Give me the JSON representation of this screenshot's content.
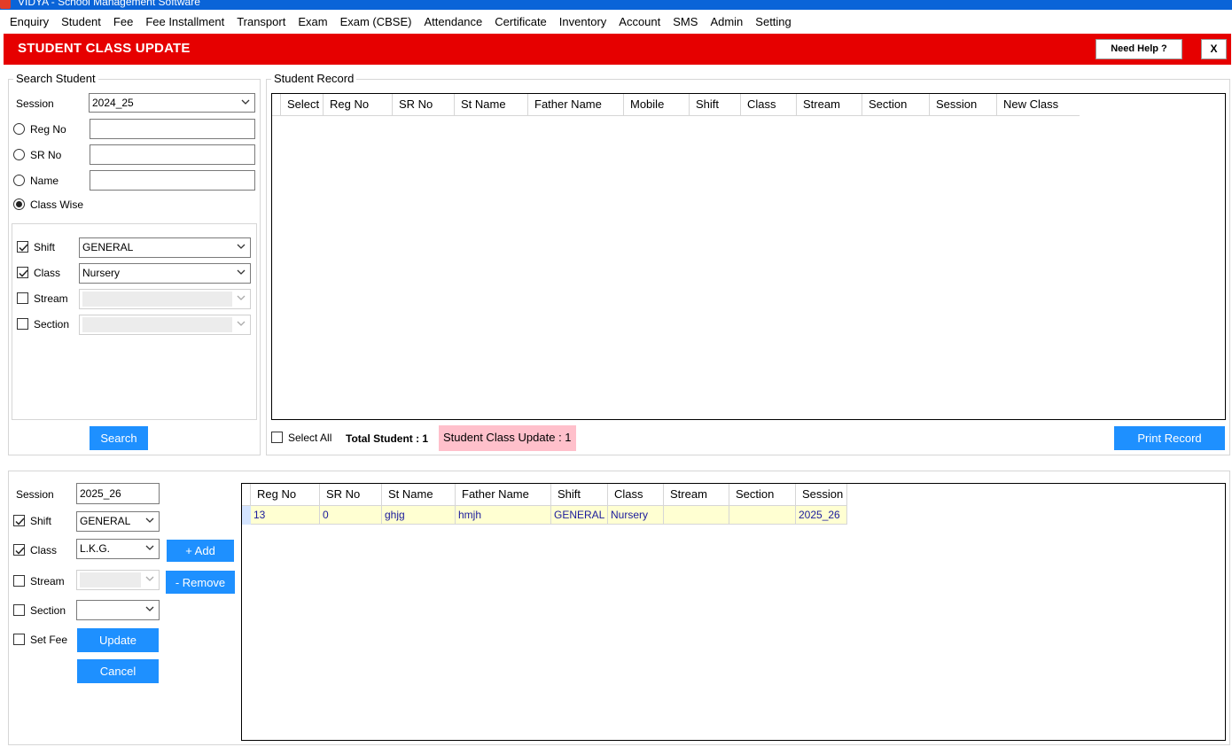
{
  "window": {
    "title": "VIDYA - School Management Software"
  },
  "menu": [
    "Enquiry",
    "Student",
    "Fee",
    "Fee Installment",
    "Transport",
    "Exam",
    "Exam (CBSE)",
    "Attendance",
    "Certificate",
    "Inventory",
    "Account",
    "SMS",
    "Admin",
    "Setting"
  ],
  "header": {
    "title": "STUDENT CLASS UPDATE",
    "help_label": "Need Help ?",
    "close_label": "X",
    "bg_color": "#e60000"
  },
  "search": {
    "legend": "Search Student",
    "session_label": "Session",
    "session_value": "2024_25",
    "reg_label": "Reg No",
    "sr_label": "SR No",
    "name_label": "Name",
    "classwise_label": "Class Wise",
    "shift_label": "Shift",
    "shift_value": "GENERAL",
    "class_label": "Class",
    "class_value": "Nursery",
    "stream_label": "Stream",
    "section_label": "Section",
    "search_button": "Search"
  },
  "record": {
    "legend": "Student Record",
    "columns": [
      "Select",
      "Reg No",
      "SR No",
      "St Name",
      "Father Name",
      "Mobile",
      "Shift",
      "Class",
      "Stream",
      "Section",
      "Session",
      "New Class"
    ],
    "select_all_label": "Select All",
    "total_label": "Total Student :  1",
    "update_badge": "Student Class Update : 1",
    "print_button": "Print Record"
  },
  "update": {
    "session_label": "Session",
    "session_value": "2025_26",
    "shift_label": "Shift",
    "shift_value": "GENERAL",
    "class_label": "Class",
    "class_value": "L.K.G.",
    "stream_label": "Stream",
    "section_label": "Section",
    "setfee_label": "Set Fee",
    "add_button": "+ Add",
    "remove_button": "- Remove",
    "update_button": "Update",
    "cancel_button": "Cancel"
  },
  "result": {
    "columns": [
      "Reg No",
      "SR No",
      "St Name",
      "Father Name",
      "Shift",
      "Class",
      "Stream",
      "Section",
      "Session"
    ],
    "rows": [
      [
        "13",
        "0",
        "ghjg",
        "hmjh",
        "GENERAL",
        "Nursery",
        "",
        "",
        "2025_26"
      ]
    ]
  },
  "colors": {
    "accent_blue": "#1e90ff",
    "header_red": "#e60000",
    "row_highlight": "#ffffd2",
    "badge_pink": "#ffc0cb"
  }
}
